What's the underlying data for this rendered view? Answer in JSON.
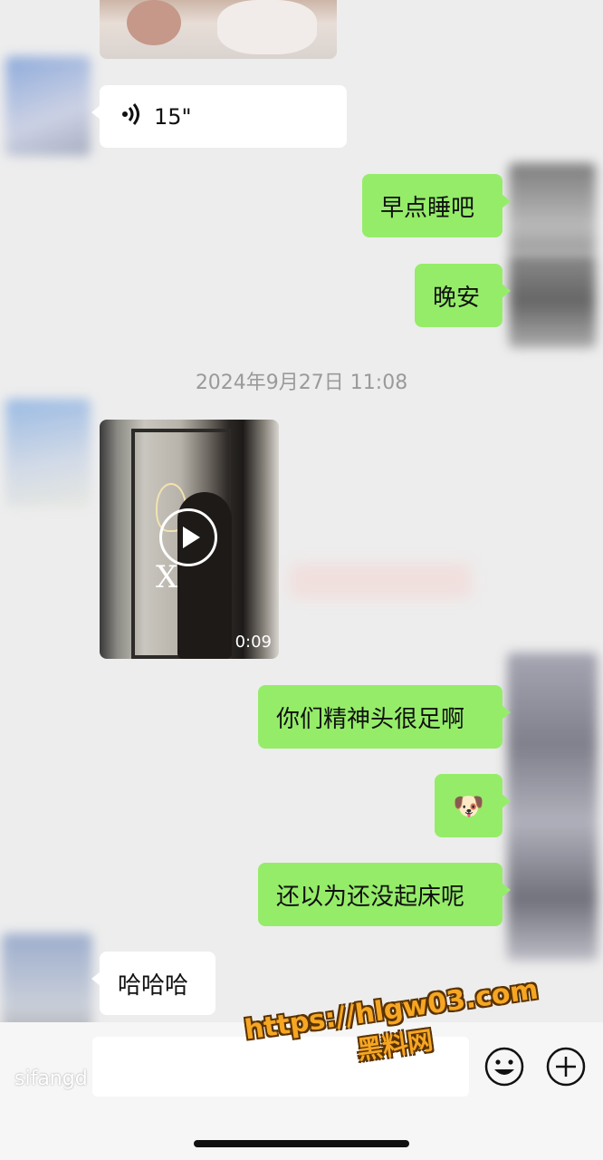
{
  "messages": {
    "voice_duration": "15\"",
    "out1": "早点睡吧",
    "out2": "晚安",
    "timestamp": "2024年9月27日 11:08",
    "video_duration": "0:09",
    "video_overlay_letter": "X",
    "out3": "你们精神头很足啊",
    "out4_emoji": "🐶",
    "out5": "还以为还没起床呢",
    "in_last": "哈哈哈"
  },
  "input_bar": {
    "left_watermark": "sifangd",
    "emoji_icon": "smiley-icon",
    "plus_icon": "plus-icon"
  },
  "watermark": {
    "url": "https://hlgw03.com",
    "name": "黑料网"
  },
  "colors": {
    "outgoing_bubble": "#95ec69",
    "incoming_bubble": "#ffffff",
    "background": "#ededed",
    "watermark_fill": "#f6a623"
  }
}
